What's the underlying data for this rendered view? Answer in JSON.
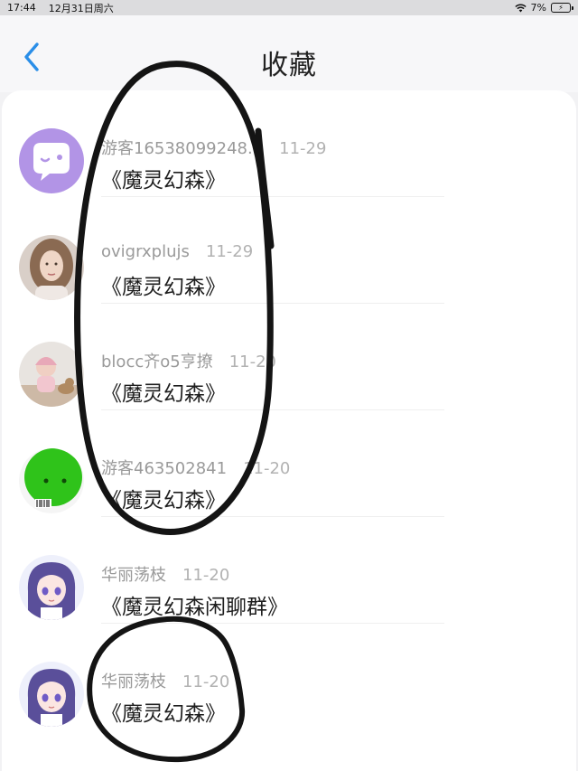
{
  "status_bar": {
    "time": "17:44",
    "date": "12月31日周六",
    "battery": "7%"
  },
  "nav": {
    "title": "收藏",
    "back_icon": "chevron-left-icon"
  },
  "colors": {
    "accent": "#2a8ee8",
    "ink": "#141414"
  },
  "favorites": [
    {
      "sender": "游客16538099248...",
      "date": "11-29",
      "title": "《魔灵幻森》",
      "avatar": "chat-bubble-icon"
    },
    {
      "sender": "ovigrxplujs",
      "date": "11-29",
      "title": "《魔灵幻森》",
      "avatar": "photo-girl"
    },
    {
      "sender": "blocc齐o5亨撩",
      "date": "11-20",
      "title": "《魔灵幻森》",
      "avatar": "photo-child-cat"
    },
    {
      "sender": "游客463502841",
      "date": "11-20",
      "title": "《魔灵幻森》",
      "avatar": "green-robot"
    },
    {
      "sender": "华丽荡枝",
      "date": "11-20",
      "title": "《魔灵幻森闲聊群》",
      "avatar": "anime-girl"
    },
    {
      "sender": "华丽荡枝",
      "date": "11-20",
      "title": "《魔灵幻森》",
      "avatar": "anime-girl"
    }
  ]
}
